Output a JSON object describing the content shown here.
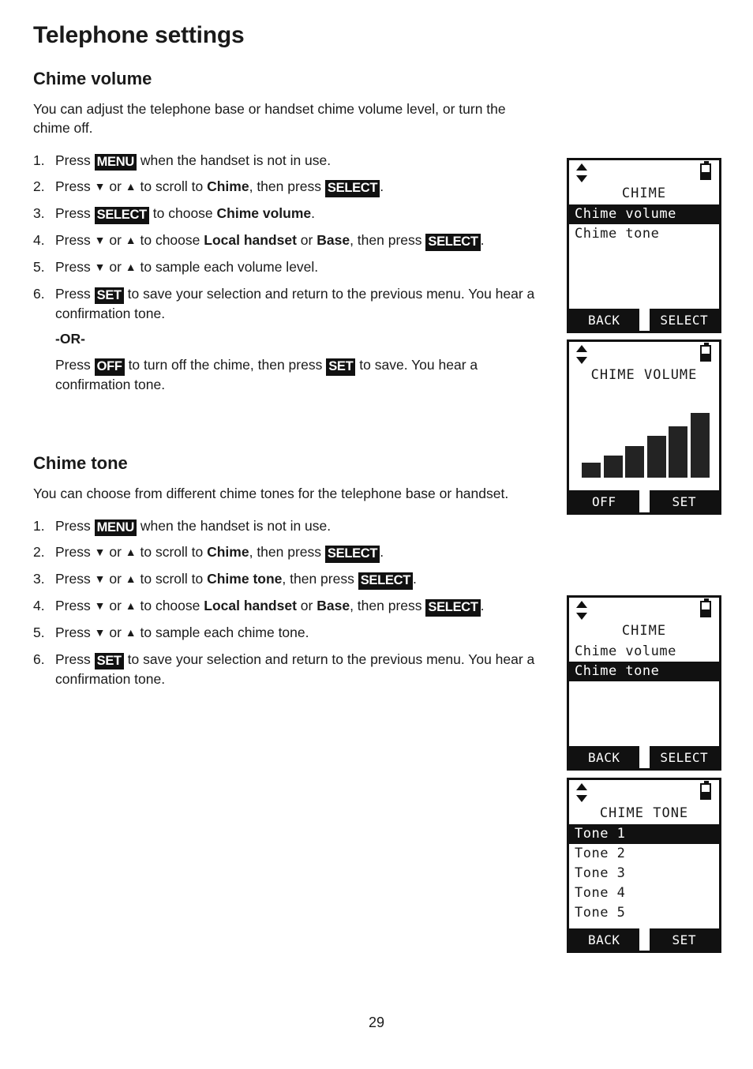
{
  "document": {
    "title": "Telephone settings",
    "page_number": "29"
  },
  "sections": [
    {
      "heading": "Chime volume",
      "intro": "You can adjust the telephone base or handset chime volume level, or turn the chime off.",
      "steps": [
        {
          "num": "1.",
          "parts": [
            {
              "t": "text",
              "v": "Press "
            },
            {
              "t": "kbd",
              "v": "MENU"
            },
            {
              "t": "text",
              "v": " when the handset is not in use."
            }
          ]
        },
        {
          "num": "2.",
          "parts": [
            {
              "t": "text",
              "v": "Press "
            },
            {
              "t": "arrow",
              "v": "▼"
            },
            {
              "t": "text",
              "v": " or "
            },
            {
              "t": "arrow",
              "v": "▲"
            },
            {
              "t": "text",
              "v": " to scroll to "
            },
            {
              "t": "bold",
              "v": "Chime"
            },
            {
              "t": "text",
              "v": ", then press "
            },
            {
              "t": "kbd",
              "v": "SELECT"
            },
            {
              "t": "text",
              "v": "."
            }
          ]
        },
        {
          "num": "3.",
          "parts": [
            {
              "t": "text",
              "v": "Press "
            },
            {
              "t": "kbd",
              "v": "SELECT"
            },
            {
              "t": "text",
              "v": " to choose "
            },
            {
              "t": "bold",
              "v": "Chime volume"
            },
            {
              "t": "text",
              "v": "."
            }
          ]
        },
        {
          "num": "4.",
          "parts": [
            {
              "t": "text",
              "v": "Press "
            },
            {
              "t": "arrow",
              "v": "▼"
            },
            {
              "t": "text",
              "v": " or "
            },
            {
              "t": "arrow",
              "v": "▲"
            },
            {
              "t": "text",
              "v": " to choose "
            },
            {
              "t": "bold",
              "v": "Local handset"
            },
            {
              "t": "text",
              "v": " or "
            },
            {
              "t": "bold",
              "v": "Base"
            },
            {
              "t": "text",
              "v": ", then press "
            },
            {
              "t": "kbd",
              "v": "SELECT"
            },
            {
              "t": "text",
              "v": "."
            }
          ]
        },
        {
          "num": "5.",
          "parts": [
            {
              "t": "text",
              "v": "Press "
            },
            {
              "t": "arrow",
              "v": "▼"
            },
            {
              "t": "text",
              "v": " or "
            },
            {
              "t": "arrow",
              "v": "▲"
            },
            {
              "t": "text",
              "v": " to sample each volume level."
            }
          ]
        },
        {
          "num": "6.",
          "parts": [
            {
              "t": "text",
              "v": "Press "
            },
            {
              "t": "kbd",
              "v": "SET"
            },
            {
              "t": "text",
              "v": " to save your selection and return to the previous menu. You hear a confirmation tone."
            }
          ]
        }
      ],
      "or_label": "-OR-",
      "or_paragraph": [
        {
          "t": "text",
          "v": "Press "
        },
        {
          "t": "kbd",
          "v": "OFF"
        },
        {
          "t": "text",
          "v": " to turn off the chime, then press "
        },
        {
          "t": "kbd",
          "v": "SET"
        },
        {
          "t": "text",
          "v": " to save. You hear a confirmation tone."
        }
      ]
    },
    {
      "heading": "Chime tone",
      "intro": "You can choose from different chime tones for the telephone base or handset.",
      "steps": [
        {
          "num": "1.",
          "parts": [
            {
              "t": "text",
              "v": "Press "
            },
            {
              "t": "kbd",
              "v": "MENU"
            },
            {
              "t": "text",
              "v": " when the handset is not in use."
            }
          ]
        },
        {
          "num": "2.",
          "parts": [
            {
              "t": "text",
              "v": "Press "
            },
            {
              "t": "arrow",
              "v": "▼"
            },
            {
              "t": "text",
              "v": " or "
            },
            {
              "t": "arrow",
              "v": "▲"
            },
            {
              "t": "text",
              "v": " to scroll to "
            },
            {
              "t": "bold",
              "v": "Chime"
            },
            {
              "t": "text",
              "v": ", then press "
            },
            {
              "t": "kbd",
              "v": "SELECT"
            },
            {
              "t": "text",
              "v": "."
            }
          ]
        },
        {
          "num": "3.",
          "parts": [
            {
              "t": "text",
              "v": "Press "
            },
            {
              "t": "arrow",
              "v": "▼"
            },
            {
              "t": "text",
              "v": " or "
            },
            {
              "t": "arrow",
              "v": "▲"
            },
            {
              "t": "text",
              "v": " to scroll to "
            },
            {
              "t": "bold",
              "v": "Chime tone"
            },
            {
              "t": "text",
              "v": ", then press "
            },
            {
              "t": "kbd",
              "v": "SELECT"
            },
            {
              "t": "text",
              "v": "."
            }
          ]
        },
        {
          "num": "4.",
          "parts": [
            {
              "t": "text",
              "v": "Press "
            },
            {
              "t": "arrow",
              "v": "▼"
            },
            {
              "t": "text",
              "v": " or "
            },
            {
              "t": "arrow",
              "v": "▲"
            },
            {
              "t": "text",
              "v": " to choose "
            },
            {
              "t": "bold",
              "v": "Local handset"
            },
            {
              "t": "text",
              "v": " or "
            },
            {
              "t": "bold",
              "v": "Base"
            },
            {
              "t": "text",
              "v": ", then press "
            },
            {
              "t": "kbd",
              "v": "SELECT"
            },
            {
              "t": "text",
              "v": "."
            }
          ]
        },
        {
          "num": "5.",
          "parts": [
            {
              "t": "text",
              "v": "Press "
            },
            {
              "t": "arrow",
              "v": "▼"
            },
            {
              "t": "text",
              "v": " or "
            },
            {
              "t": "arrow",
              "v": "▲"
            },
            {
              "t": "text",
              "v": " to sample each chime tone."
            }
          ]
        },
        {
          "num": "6.",
          "parts": [
            {
              "t": "text",
              "v": "Press "
            },
            {
              "t": "kbd",
              "v": "SET"
            },
            {
              "t": "text",
              "v": " to save your selection and return to the previous menu. You hear a confirmation tone."
            }
          ]
        }
      ]
    }
  ],
  "screens": [
    {
      "id": "chime-menu-volume-selected",
      "status": {
        "scroll_icon": "scroll-up-down-icon",
        "battery_icon": "battery-icon"
      },
      "title": "CHIME",
      "rows": [
        {
          "label": "Chime volume",
          "selected": true
        },
        {
          "label": "Chime tone",
          "selected": false
        }
      ],
      "softkeys": {
        "left": "BACK",
        "right": "SELECT"
      }
    },
    {
      "id": "chime-volume-level",
      "status": {
        "scroll_icon": "scroll-up-down-icon",
        "battery_icon": "battery-icon"
      },
      "title": "CHIME VOLUME",
      "volume_bars": [
        18,
        27,
        38,
        50,
        62,
        78
      ],
      "softkeys": {
        "left": "OFF",
        "right": "SET"
      }
    },
    {
      "id": "chime-menu-tone-selected",
      "status": {
        "scroll_icon": "scroll-up-down-icon",
        "battery_icon": "battery-icon"
      },
      "title": "CHIME",
      "rows": [
        {
          "label": "Chime volume",
          "selected": false
        },
        {
          "label": "Chime tone",
          "selected": true
        }
      ],
      "softkeys": {
        "left": "BACK",
        "right": "SELECT"
      }
    },
    {
      "id": "chime-tone-list",
      "status": {
        "scroll_icon": "scroll-up-down-icon",
        "battery_icon": "battery-icon"
      },
      "title": "CHIME TONE",
      "rows": [
        {
          "label": "Tone 1",
          "selected": true
        },
        {
          "label": "Tone 2",
          "selected": false
        },
        {
          "label": "Tone 3",
          "selected": false
        },
        {
          "label": "Tone 4",
          "selected": false
        },
        {
          "label": "Tone 5",
          "selected": false
        }
      ],
      "softkeys": {
        "left": "BACK",
        "right": "SET"
      }
    }
  ],
  "colors": {
    "ink": "#1a1a1a",
    "lcd_dark": "#111111",
    "lcd_light": "#ffffff",
    "bar_fill": "#232323"
  }
}
